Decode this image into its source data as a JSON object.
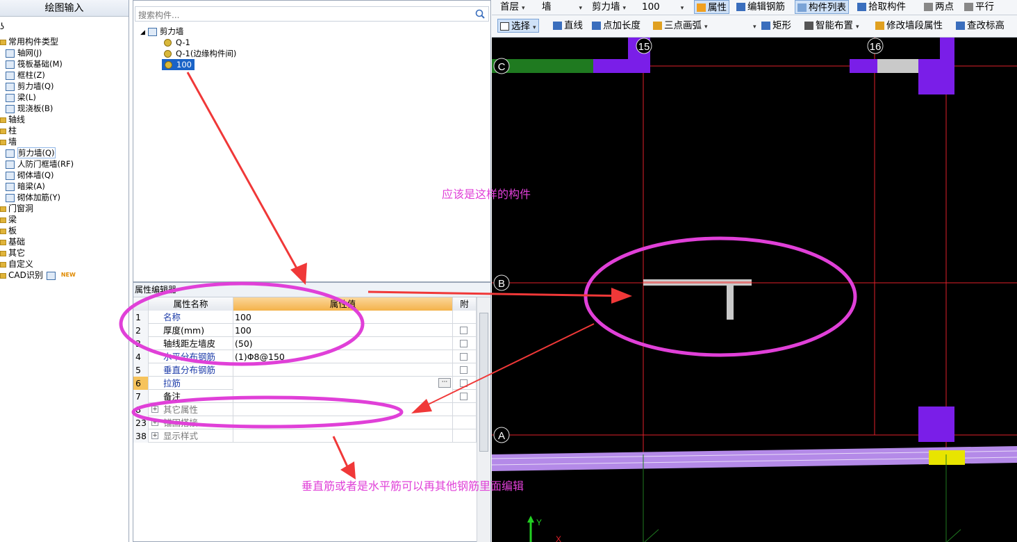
{
  "left_panel": {
    "title": "绘图输入",
    "root_marker": "ʖ",
    "groups": [
      {
        "label": "常用构件类型"
      },
      {
        "label": "轴网(J)"
      },
      {
        "label": "筏板基础(M)"
      },
      {
        "label": "框柱(Z)"
      },
      {
        "label": "剪力墙(Q)"
      },
      {
        "label": "梁(L)"
      },
      {
        "label": "现浇板(B)"
      },
      {
        "label": "轴线"
      },
      {
        "label": "柱"
      },
      {
        "label": "墙"
      },
      {
        "label": "剪力墙(Q)"
      },
      {
        "label": "人防门框墙(RF)"
      },
      {
        "label": "砌体墙(Q)"
      },
      {
        "label": "暗梁(A)"
      },
      {
        "label": "砌体加筋(Y)"
      },
      {
        "label": "门窗洞"
      },
      {
        "label": "梁"
      },
      {
        "label": "板"
      },
      {
        "label": "基础"
      },
      {
        "label": "其它"
      },
      {
        "label": "自定义"
      },
      {
        "label": "CAD识别"
      }
    ],
    "new_badge": "NEW"
  },
  "component_list": {
    "search_placeholder": "搜索构件...",
    "root": "剪力墙",
    "items": [
      "Q-1",
      "Q-1(边缘构件间)",
      "100"
    ]
  },
  "property_editor": {
    "title": "属性编辑器",
    "header": {
      "name": "属性名称",
      "value": "属性值",
      "attach": "附"
    },
    "rows": [
      {
        "num": "1",
        "name": "名称",
        "value": "100"
      },
      {
        "num": "2",
        "name": "厚度(mm)",
        "value": "100"
      },
      {
        "num": "3",
        "name": "轴线距左墙皮",
        "value": "(50)"
      },
      {
        "num": "4",
        "name": "水平分布钢筋",
        "value": "(1)Φ8@150"
      },
      {
        "num": "5",
        "name": "垂直分布钢筋",
        "value": ""
      },
      {
        "num": "6",
        "name": "拉筋",
        "value": ""
      },
      {
        "num": "7",
        "name": "备注",
        "value": ""
      },
      {
        "num": "8",
        "name": "其它属性",
        "value": ""
      },
      {
        "num": "23",
        "name": "锚固搭接",
        "value": ""
      },
      {
        "num": "38",
        "name": "显示样式",
        "value": ""
      }
    ],
    "ellipsis": "···"
  },
  "toolbar1": {
    "floor": "首层",
    "category": "墙",
    "type": "剪力墙",
    "component": "100",
    "properties": "属性",
    "edit_rebar": "编辑钢筋",
    "component_list": "构件列表",
    "pick": "拾取构件",
    "two_points": "两点",
    "parallel": "平行"
  },
  "toolbar2": {
    "select": "选择",
    "line": "直线",
    "point_length": "点加长度",
    "arc": "三点画弧",
    "rect": "矩形",
    "smart": "智能布置",
    "modify_wall": "修改墙段属性",
    "check_elev": "查改标高"
  },
  "canvas": {
    "axis_labels": {
      "col15": "15",
      "col16": "16",
      "rowC": "C",
      "rowB": "B",
      "rowA": "A",
      "ucs_y": "Y",
      "ucs_x": "X"
    },
    "colors": {
      "background": "#000000",
      "grid": "#e0202a",
      "wall": "#7a1ee8",
      "wall_green": "#1f7a20",
      "selected": "#c9c9c9",
      "highlight": "#e8e400",
      "strip": "#b48ae8"
    }
  },
  "annotations": {
    "component_note": "应该是这样的构件",
    "rebar_note": "垂直筋或者是水平筋可以再其他钢筋里面编辑",
    "color": "#e040d8"
  }
}
